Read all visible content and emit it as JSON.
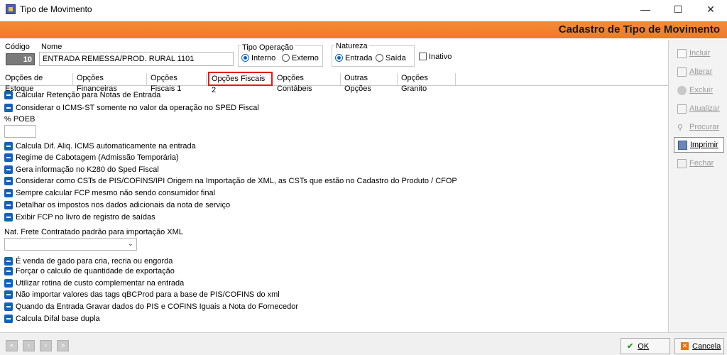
{
  "window": {
    "title": "Tipo de Movimento",
    "minimize": "—",
    "maximize": "☐",
    "close": "✕"
  },
  "header": {
    "title": "Cadastro de Tipo de Movimento"
  },
  "form": {
    "codigo_label": "Código",
    "codigo_value": "10",
    "nome_label": "Nome",
    "nome_value": "ENTRADA REMESSA/PROD. RURAL 1101",
    "tipo_operacao_label": "Tipo Operação",
    "interno": "Interno",
    "externo": "Externo",
    "natureza_label": "Natureza",
    "entrada": "Entrada",
    "saida": "Saída",
    "inativo": "Inativo"
  },
  "tabs": [
    "Opções de Estoque",
    "Opções Financeiras",
    "Opções Fiscais 1",
    "Opções Fiscais 2",
    "Opções Contábeis",
    "Outras Opções",
    "Opções Granito"
  ],
  "options": {
    "o1": "Calcular Retenção para Notas de Entrada",
    "o2": "Considerar o ICMS-ST somente no valor da operação no SPED Fiscal",
    "poeb_label": "% POEB",
    "o3": "Calcula Dif. Aliq. ICMS automaticamente na entrada",
    "o4": "Regime de Cabotagem (Admissão Temporária)",
    "o5": "Gera informação no K280 do Sped Fiscal",
    "o6": "Considerar como CSTs de PIS/COFINS/IPI Origem na Importação de XML, as CSTs que estão no Cadastro do Produto / CFOP",
    "o7": "Sempre calcular FCP mesmo não sendo consumidor final",
    "o8": "Detalhar os impostos nos dados adicionais da nota de serviço",
    "o9": "Exibir FCP no livro de registro de saídas",
    "frete_label": "Nat. Frete Contratado padrão para importação XML",
    "o10": "É venda de gado para cria, recria ou engorda",
    "o11": "Forçar o calculo de quantidade de exportação",
    "o12": "Utilizar rotina de custo complementar na entrada",
    "o13": "Não importar valores das tags qBCProd para a base de PIS/COFINS do xml",
    "o14": "Quando da Entrada Gravar dados do PIS e COFINS Iguais a Nota do Fornecedor",
    "o15": "Calcula Difal base dupla"
  },
  "sidebar": {
    "incluir": "Incluir",
    "alterar": "Alterar",
    "excluir": "Excluir",
    "atualizar": "Atualizar",
    "procurar": "Procurar",
    "imprimir": "Imprimir",
    "fechar": "Fechar"
  },
  "footer": {
    "ok": "OK",
    "cancela": "Cancela"
  },
  "colors": {
    "accent_orange": "#f58a3a",
    "check_blue": "#1462b8",
    "active_tab_border": "#e21a1a"
  }
}
